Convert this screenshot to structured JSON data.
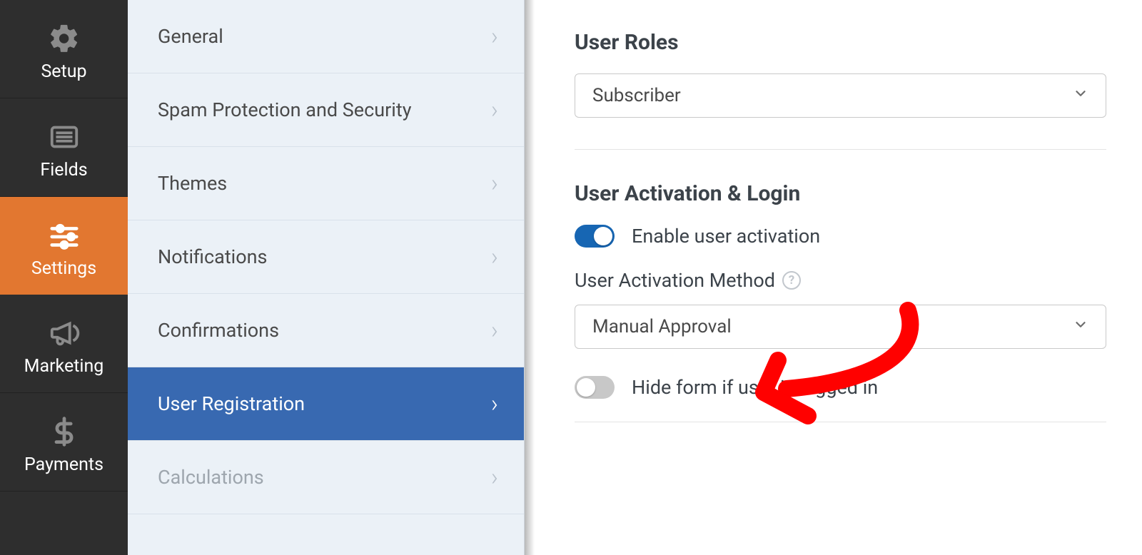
{
  "primary_nav": {
    "items": [
      {
        "label": "Setup",
        "icon": "gear-icon",
        "active": false
      },
      {
        "label": "Fields",
        "icon": "list-icon",
        "active": false
      },
      {
        "label": "Settings",
        "icon": "sliders-icon",
        "active": true
      },
      {
        "label": "Marketing",
        "icon": "bullhorn-icon",
        "active": false
      },
      {
        "label": "Payments",
        "icon": "dollar-icon",
        "active": false
      }
    ]
  },
  "settings_list": {
    "items": [
      {
        "label": "General"
      },
      {
        "label": "Spam Protection and Security"
      },
      {
        "label": "Themes"
      },
      {
        "label": "Notifications"
      },
      {
        "label": "Confirmations"
      },
      {
        "label": "User Registration",
        "active": true
      },
      {
        "label": "Calculations",
        "dim": true
      }
    ]
  },
  "content": {
    "user_roles_title": "User Roles",
    "user_roles_value": "Subscriber",
    "activation_title": "User Activation & Login",
    "enable_activation_label": "Enable user activation",
    "activation_method_label": "User Activation Method",
    "activation_method_value": "Manual Approval",
    "hide_form_label": "Hide form if user is logged in"
  },
  "colors": {
    "accent_orange": "#e27730",
    "accent_blue": "#3869b1",
    "toggle_on": "#1766b3",
    "callout_red": "#ff0000"
  }
}
